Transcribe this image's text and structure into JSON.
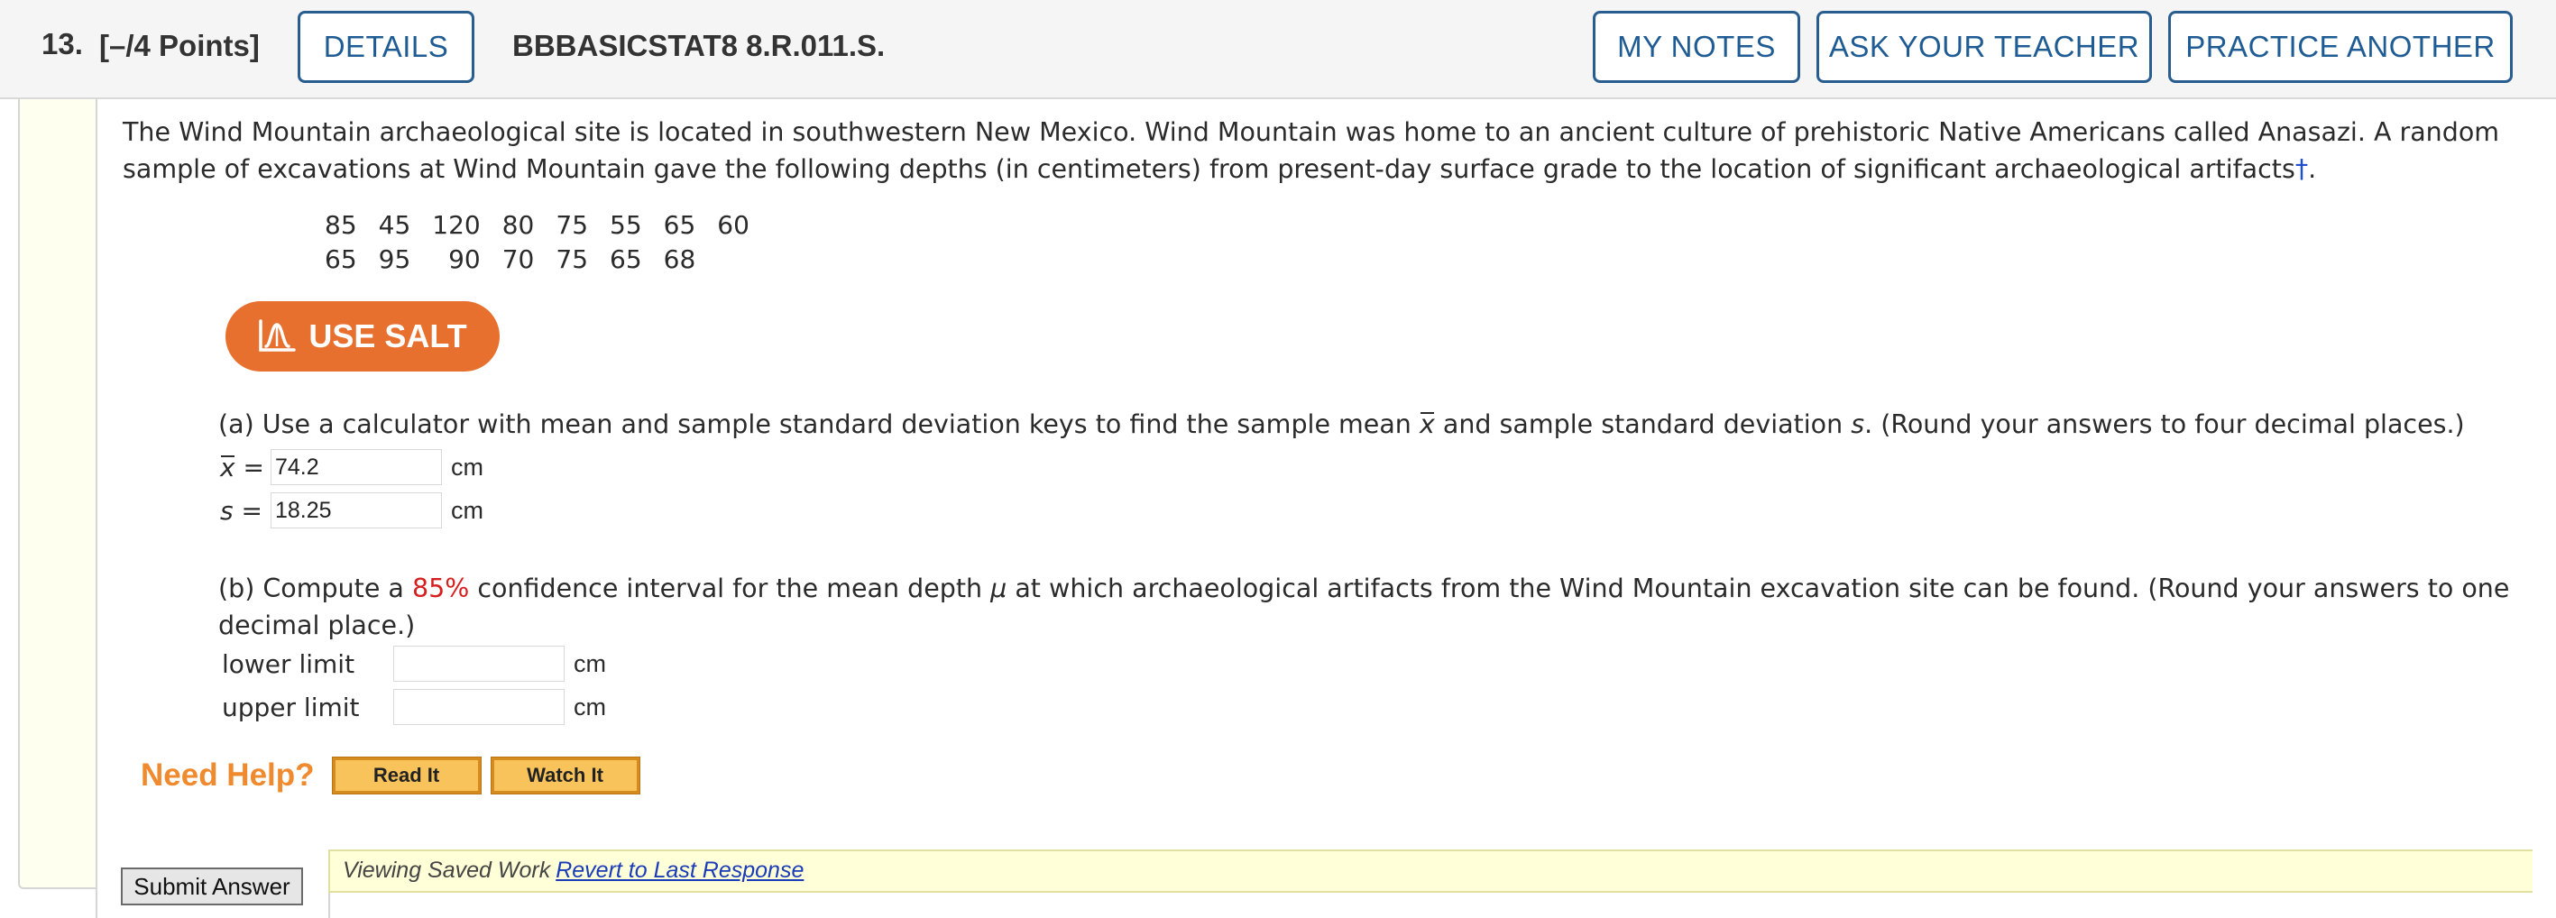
{
  "header": {
    "question_number": "13.",
    "points": "[–/4 Points]",
    "details_label": "DETAILS",
    "code": "BBBASICSTAT8 8.R.011.S.",
    "my_notes_label": "MY NOTES",
    "ask_teacher_label": "ASK YOUR TEACHER",
    "practice_another_label": "PRACTICE ANOTHER"
  },
  "intro": {
    "text": "The Wind Mountain archaeological site is located in southwestern New Mexico. Wind Mountain was home to an ancient culture of prehistoric Native Americans called Anasazi. A random sample of excavations at Wind Mountain gave the following depths (in centimeters) from present-day surface grade to the location of significant archaeological artifacts",
    "dagger": "†",
    "end": "."
  },
  "data_rows": [
    [
      "85",
      "45",
      "120",
      "80",
      "75",
      "55",
      "65",
      "60"
    ],
    [
      "65",
      "95",
      "90",
      "70",
      "75",
      "65",
      "68"
    ]
  ],
  "salt_button": {
    "label": "USE SALT",
    "icon": "salt-chart-icon"
  },
  "part_a": {
    "prefix": "(a) Use a calculator with mean and sample standard deviation keys to find the sample mean ",
    "xbar": "x",
    "middle": " and sample standard deviation ",
    "s": "s",
    "suffix": ". (Round your answers to four decimal places.)",
    "mean_label": "x",
    "eq": "=",
    "mean_value": "74.2",
    "sd_label": "s",
    "sd_value": "18.25",
    "unit": "cm"
  },
  "part_b": {
    "prefix": "(b) Compute a ",
    "confidence": "85%",
    "middle": " confidence interval for the mean depth ",
    "mu": "μ",
    "suffix": " at which archaeological artifacts from the Wind Mountain excavation site can be found. (Round your answers to one decimal place.)",
    "lower_label": "lower limit",
    "lower_value": "",
    "upper_label": "upper limit",
    "upper_value": "",
    "unit": "cm"
  },
  "help": {
    "label": "Need Help?",
    "read_it": "Read It",
    "watch_it": "Watch It"
  },
  "footer": {
    "submit_label": "Submit Answer",
    "viewing_text": "Viewing Saved Work",
    "revert_link": "Revert to Last Response"
  },
  "colors": {
    "accent_blue": "#1f5c94",
    "salt_orange": "#e8702f",
    "help_orange": "#ef8a2e",
    "highlight_red": "#d62020"
  }
}
